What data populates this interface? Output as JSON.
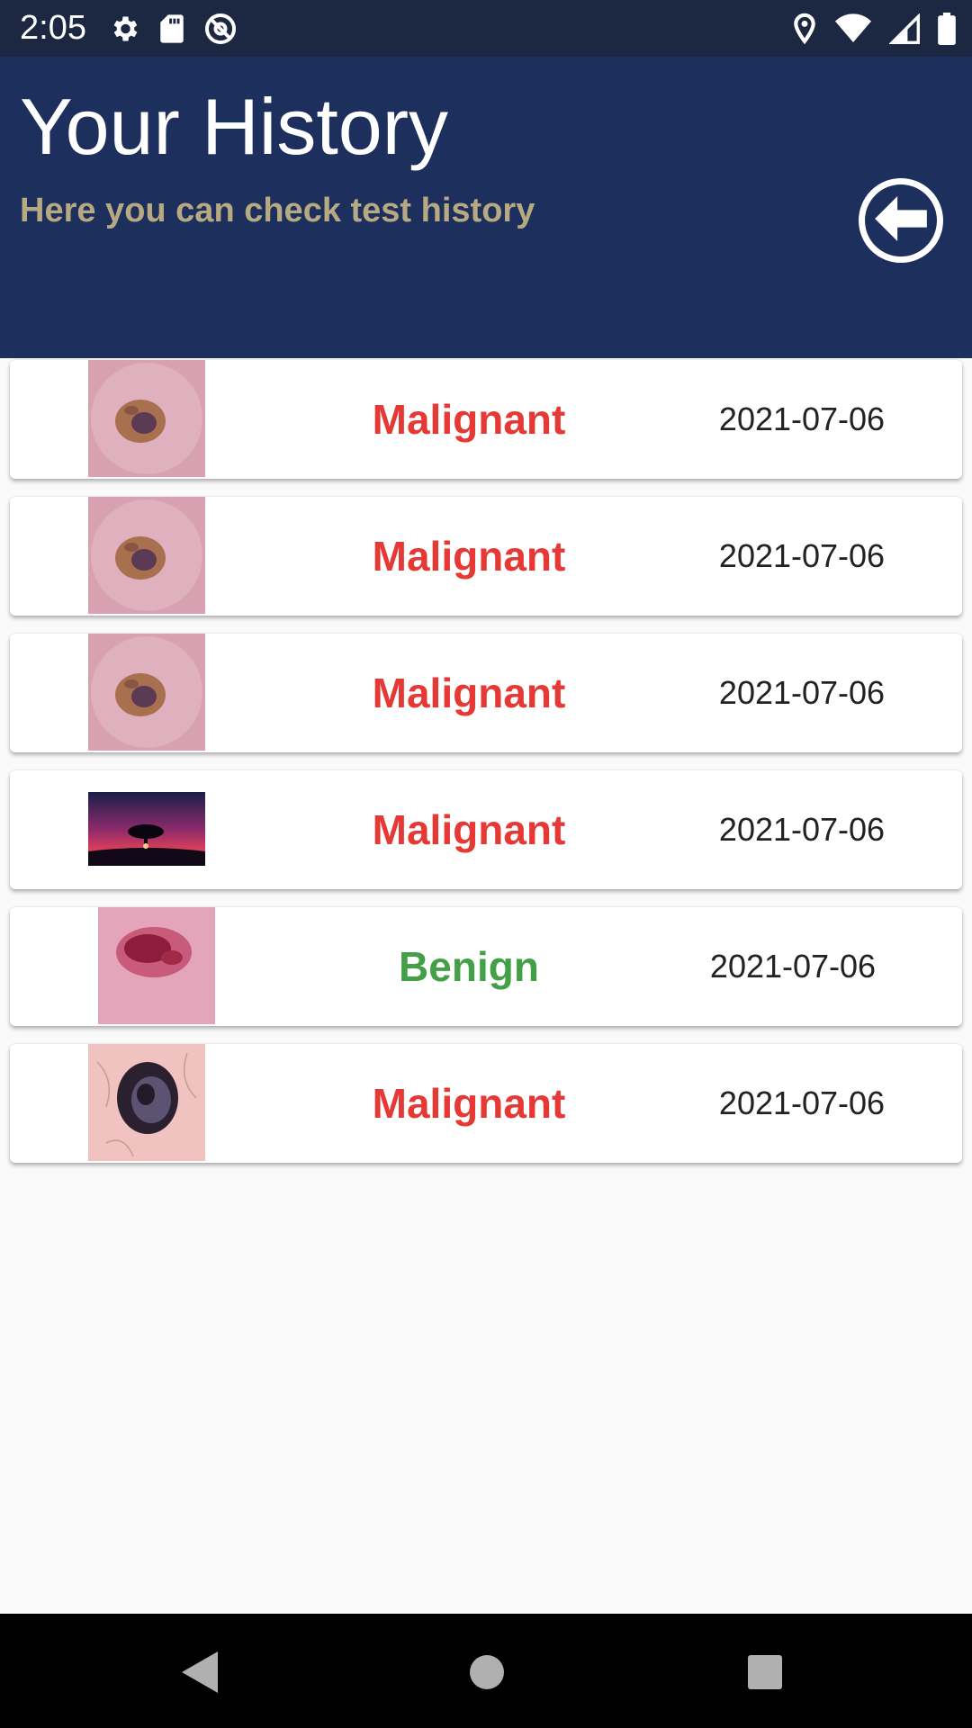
{
  "status_bar": {
    "time": "2:05",
    "left_icons": [
      "settings-icon",
      "sd-card-icon",
      "at-sign-icon"
    ],
    "right_icons": [
      "location-icon",
      "wifi-icon",
      "signal-icon",
      "battery-icon"
    ]
  },
  "header": {
    "title": "Your History",
    "subtitle": "Here you can check test history",
    "back_icon": "arrow-left-circle-icon",
    "colors": {
      "background": "#1c2f5d",
      "subtitle": "#b7aa82"
    }
  },
  "history": [
    {
      "result": "Malignant",
      "status": "malignant",
      "date": "2021-07-06",
      "image": "skin-lesion-image"
    },
    {
      "result": "Malignant",
      "status": "malignant",
      "date": "2021-07-06",
      "image": "skin-lesion-image"
    },
    {
      "result": "Malignant",
      "status": "malignant",
      "date": "2021-07-06",
      "image": "skin-lesion-image"
    },
    {
      "result": "Malignant",
      "status": "malignant",
      "date": "2021-07-06",
      "image": "sunset-tree-image"
    },
    {
      "result": "Benign",
      "status": "benign",
      "date": "2021-07-06",
      "image": "red-lesion-image"
    },
    {
      "result": "Malignant",
      "status": "malignant",
      "date": "2021-07-06",
      "image": "dark-mole-image"
    }
  ],
  "colors": {
    "malignant": "#e53935",
    "benign": "#43a047"
  },
  "nav_bar": {
    "icons": [
      "back-triangle-icon",
      "home-circle-icon",
      "recents-square-icon"
    ]
  }
}
